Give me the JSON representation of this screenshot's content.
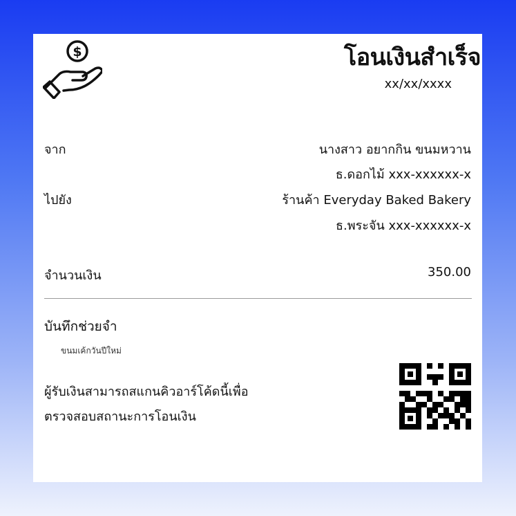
{
  "header": {
    "title": "โอนเงินสำเร็จ",
    "date": "xx/xx/xxxx"
  },
  "from": {
    "label": "จาก",
    "name": "นางสาว อยากกิน ขนมหวาน",
    "account": "ธ.ดอกไม้ xxx-xxxxxx-x"
  },
  "to": {
    "label": "ไปยัง",
    "name": "ร้านค้า Everyday Baked Bakery",
    "account": "ธ.พระจัน xxx-xxxxxx-x"
  },
  "amount": {
    "label": "จำนวนเงิน",
    "value": "350.00"
  },
  "memo": {
    "label": "บันทึกช่วยจำ",
    "text": "ขนมเค้กวันปีใหม่"
  },
  "verify": {
    "line1": "ผู้รับเงินสามารถสแกนคิวอาร์โค้ดนี้เพื่อ",
    "line2": "ตรวจสอบสถานะการโอนเงิน"
  },
  "icons": {
    "logo": "hand-holding-dollar-coin-icon",
    "qr": "qr-code-icon"
  },
  "colors": {
    "background_top": "#1a3cf2",
    "background_bottom": "#eef2fd",
    "card": "#ffffff"
  }
}
